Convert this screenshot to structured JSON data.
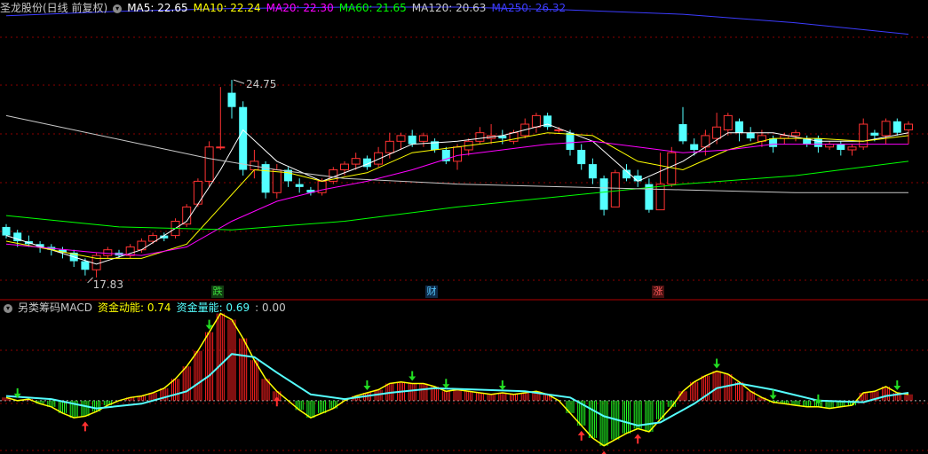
{
  "main_header": {
    "stock": "圣龙股份(日线 前复权)",
    "ma": [
      {
        "label": "MA5: 22.65",
        "color": "#ffffff"
      },
      {
        "label": "MA10: 22.24",
        "color": "#ffff00"
      },
      {
        "label": "MA20: 22.30",
        "color": "#ff00ff"
      },
      {
        "label": "MA60: 21.65",
        "color": "#00ff00"
      },
      {
        "label": "MA120: 20.63",
        "color": "#c8c8c8"
      },
      {
        "label": "MA250: 26.32",
        "color": "#3c3cff"
      }
    ]
  },
  "sub_header": {
    "indicator": "另类筹码MACD",
    "items": [
      {
        "label": "资金动能: 0.74",
        "color": "#ffff00"
      },
      {
        "label": "资金量能: 0.69",
        "color": "#55ffff"
      },
      {
        "label": ": 0.00",
        "color": "#c8c8c8"
      }
    ]
  },
  "annotations": {
    "high": "24.75",
    "low": "17.83"
  },
  "event_tags": [
    {
      "text": "跌",
      "color": "#3cdc3c",
      "bg": "#123d12"
    },
    {
      "text": "财",
      "color": "#55c8ff",
      "bg": "#0e2a48"
    },
    {
      "text": "涨",
      "color": "#ff5a5a",
      "bg": "#481010"
    }
  ],
  "colors": {
    "up": "#ff3232",
    "down": "#54ffff",
    "grid": "#8b0000",
    "macd_up": "#ff2020",
    "macd_down": "#22ff22"
  },
  "chart_data": [
    {
      "type": "candlestick",
      "price_range": [
        17.3,
        27.3
      ],
      "candles": [
        [
          19.6,
          19.7,
          19.2,
          19.3
        ],
        [
          19.4,
          19.5,
          18.9,
          19.1
        ],
        [
          19.1,
          19.3,
          18.9,
          19.0
        ],
        [
          19.0,
          19.1,
          18.7,
          18.9
        ],
        [
          18.9,
          19.0,
          18.6,
          18.8
        ],
        [
          18.8,
          18.9,
          18.5,
          18.7
        ],
        [
          18.7,
          18.8,
          18.2,
          18.4
        ],
        [
          18.4,
          18.5,
          17.9,
          18.1
        ],
        [
          18.1,
          18.7,
          17.83,
          18.6
        ],
        [
          18.6,
          18.9,
          18.5,
          18.8
        ],
        [
          18.7,
          18.8,
          18.5,
          18.6
        ],
        [
          18.6,
          19.0,
          18.5,
          18.9
        ],
        [
          18.8,
          19.2,
          18.7,
          19.1
        ],
        [
          19.1,
          19.4,
          19.0,
          19.3
        ],
        [
          19.3,
          19.4,
          19.1,
          19.2
        ],
        [
          19.3,
          19.9,
          19.2,
          19.8
        ],
        [
          19.7,
          20.4,
          19.6,
          20.3
        ],
        [
          20.4,
          21.3,
          20.3,
          21.2
        ],
        [
          21.2,
          22.6,
          21.0,
          22.4
        ],
        [
          22.4,
          24.5,
          22.3,
          22.4
        ],
        [
          24.3,
          24.75,
          23.4,
          23.8
        ],
        [
          23.8,
          24.0,
          21.4,
          21.6
        ],
        [
          21.6,
          22.3,
          21.3,
          21.9
        ],
        [
          21.8,
          21.9,
          20.6,
          20.8
        ],
        [
          20.8,
          21.8,
          20.6,
          21.6
        ],
        [
          21.6,
          21.7,
          21.0,
          21.2
        ],
        [
          21.1,
          21.3,
          20.8,
          21.0
        ],
        [
          20.9,
          21.0,
          20.7,
          20.8
        ],
        [
          20.8,
          21.3,
          20.7,
          21.2
        ],
        [
          21.2,
          21.7,
          21.1,
          21.6
        ],
        [
          21.6,
          21.9,
          21.4,
          21.8
        ],
        [
          21.8,
          22.2,
          21.6,
          22.0
        ],
        [
          22.0,
          22.1,
          21.6,
          21.7
        ],
        [
          21.8,
          22.4,
          21.7,
          22.2
        ],
        [
          22.2,
          22.9,
          22.0,
          22.6
        ],
        [
          22.6,
          22.9,
          22.3,
          22.8
        ],
        [
          22.8,
          23.0,
          22.4,
          22.5
        ],
        [
          22.6,
          22.9,
          22.4,
          22.8
        ],
        [
          22.6,
          22.7,
          22.2,
          22.3
        ],
        [
          22.3,
          22.4,
          21.8,
          21.9
        ],
        [
          21.9,
          22.5,
          21.6,
          22.4
        ],
        [
          22.3,
          22.7,
          22.1,
          22.6
        ],
        [
          22.6,
          23.1,
          22.5,
          22.9
        ],
        [
          22.7,
          23.2,
          22.5,
          22.8
        ],
        [
          22.8,
          23.0,
          22.5,
          22.7
        ],
        [
          22.6,
          23.0,
          22.5,
          22.9
        ],
        [
          22.8,
          23.4,
          22.7,
          23.2
        ],
        [
          23.1,
          23.6,
          22.9,
          23.5
        ],
        [
          23.5,
          23.6,
          23.0,
          23.1
        ],
        [
          23.0,
          23.1,
          22.9,
          23.0
        ],
        [
          22.9,
          23.0,
          22.1,
          22.3
        ],
        [
          22.3,
          22.5,
          21.6,
          21.8
        ],
        [
          21.8,
          22.0,
          21.1,
          21.3
        ],
        [
          21.3,
          21.4,
          20.0,
          20.2
        ],
        [
          20.3,
          21.6,
          20.3,
          21.5
        ],
        [
          21.6,
          21.8,
          21.2,
          21.3
        ],
        [
          21.4,
          21.6,
          21.0,
          21.2
        ],
        [
          21.1,
          21.3,
          20.1,
          20.2
        ],
        [
          20.2,
          22.2,
          20.8,
          21.1
        ],
        [
          21.1,
          22.4,
          21.0,
          22.2
        ],
        [
          23.2,
          23.8,
          22.5,
          22.6
        ],
        [
          22.5,
          22.7,
          22.1,
          22.3
        ],
        [
          22.4,
          23.0,
          22.1,
          22.8
        ],
        [
          22.7,
          23.6,
          22.5,
          23.1
        ],
        [
          23.0,
          23.6,
          22.8,
          23.5
        ],
        [
          23.3,
          23.4,
          22.6,
          22.9
        ],
        [
          22.9,
          23.1,
          22.6,
          22.7
        ],
        [
          22.6,
          23.0,
          22.4,
          22.8
        ],
        [
          22.7,
          22.8,
          22.2,
          22.4
        ],
        [
          22.7,
          22.9,
          22.5,
          22.8
        ],
        [
          22.8,
          23.0,
          22.6,
          22.9
        ],
        [
          22.7,
          22.8,
          22.4,
          22.5
        ],
        [
          22.7,
          22.8,
          22.2,
          22.4
        ],
        [
          22.4,
          22.6,
          22.3,
          22.5
        ],
        [
          22.5,
          22.6,
          22.1,
          22.3
        ],
        [
          22.3,
          22.5,
          22.1,
          22.4
        ],
        [
          22.4,
          23.4,
          22.3,
          23.2
        ],
        [
          22.9,
          23.0,
          22.6,
          22.8
        ],
        [
          22.8,
          23.4,
          22.5,
          23.3
        ],
        [
          23.3,
          23.4,
          22.8,
          22.9
        ],
        [
          23.0,
          23.3,
          22.5,
          23.2
        ]
      ],
      "ma_lines": [
        {
          "name": "MA5",
          "color": "#ffffff",
          "values": [
            [
              0,
              19.3
            ],
            [
              8,
              18.3
            ],
            [
              12,
              18.8
            ],
            [
              16,
              19.8
            ],
            [
              19,
              21.6
            ],
            [
              21,
              23.0
            ],
            [
              24,
              21.9
            ],
            [
              28,
              21.2
            ],
            [
              32,
              21.8
            ],
            [
              36,
              22.5
            ],
            [
              40,
              22.6
            ],
            [
              44,
              22.8
            ],
            [
              48,
              23.2
            ],
            [
              52,
              22.6
            ],
            [
              56,
              21.2
            ],
            [
              60,
              21.9
            ],
            [
              64,
              22.9
            ],
            [
              68,
              22.9
            ],
            [
              72,
              22.6
            ],
            [
              76,
              22.6
            ],
            [
              80,
              22.9
            ]
          ]
        },
        {
          "name": "MA10",
          "color": "#ffff00",
          "values": [
            [
              0,
              19.1
            ],
            [
              8,
              18.5
            ],
            [
              12,
              18.5
            ],
            [
              16,
              19.0
            ],
            [
              19,
              20.3
            ],
            [
              22,
              21.6
            ],
            [
              25,
              21.5
            ],
            [
              28,
              21.2
            ],
            [
              32,
              21.5
            ],
            [
              36,
              22.2
            ],
            [
              40,
              22.4
            ],
            [
              44,
              22.6
            ],
            [
              48,
              22.9
            ],
            [
              52,
              22.8
            ],
            [
              56,
              21.9
            ],
            [
              60,
              21.6
            ],
            [
              64,
              22.3
            ],
            [
              68,
              22.7
            ],
            [
              72,
              22.7
            ],
            [
              76,
              22.6
            ],
            [
              80,
              22.8
            ]
          ]
        },
        {
          "name": "MA20",
          "color": "#ff00ff",
          "values": [
            [
              0,
              19.0
            ],
            [
              8,
              18.7
            ],
            [
              12,
              18.6
            ],
            [
              16,
              18.9
            ],
            [
              20,
              19.8
            ],
            [
              24,
              20.5
            ],
            [
              28,
              20.9
            ],
            [
              32,
              21.2
            ],
            [
              36,
              21.6
            ],
            [
              40,
              22.1
            ],
            [
              44,
              22.3
            ],
            [
              48,
              22.5
            ],
            [
              52,
              22.6
            ],
            [
              56,
              22.4
            ],
            [
              60,
              22.2
            ],
            [
              64,
              22.3
            ],
            [
              68,
              22.5
            ],
            [
              72,
              22.5
            ],
            [
              76,
              22.5
            ],
            [
              80,
              22.5
            ]
          ]
        },
        {
          "name": "MA60",
          "color": "#00ff00",
          "values": [
            [
              0,
              20.0
            ],
            [
              10,
              19.6
            ],
            [
              20,
              19.5
            ],
            [
              30,
              19.8
            ],
            [
              40,
              20.3
            ],
            [
              50,
              20.7
            ],
            [
              60,
              21.1
            ],
            [
              70,
              21.4
            ],
            [
              80,
              21.9
            ]
          ]
        },
        {
          "name": "MA120",
          "color": "#c8c8c8",
          "values": [
            [
              0,
              23.5
            ],
            [
              6,
              23.0
            ],
            [
              12,
              22.5
            ],
            [
              18,
              22.0
            ],
            [
              24,
              21.6
            ],
            [
              30,
              21.3
            ],
            [
              40,
              21.1
            ],
            [
              50,
              21.0
            ],
            [
              60,
              20.9
            ],
            [
              70,
              20.8
            ],
            [
              80,
              20.8
            ]
          ]
        },
        {
          "name": "MA250",
          "color": "#3c3cff",
          "values": [
            [
              0,
              27.0
            ],
            [
              10,
              27.15
            ],
            [
              20,
              27.25
            ],
            [
              30,
              27.3
            ],
            [
              40,
              27.3
            ],
            [
              50,
              27.2
            ],
            [
              60,
              27.05
            ],
            [
              70,
              26.75
            ],
            [
              80,
              26.35
            ]
          ]
        }
      ]
    },
    {
      "type": "macd-bars",
      "value_range": [
        -1.6,
        2.9
      ],
      "histogram": [
        0.1,
        0.0,
        0.05,
        -0.1,
        -0.2,
        -0.4,
        -0.55,
        -0.5,
        -0.35,
        -0.15,
        0.0,
        0.1,
        0.15,
        0.25,
        0.4,
        0.7,
        1.1,
        1.6,
        2.2,
        2.8,
        2.6,
        2.0,
        1.3,
        0.7,
        0.3,
        0.0,
        -0.3,
        -0.55,
        -0.4,
        -0.25,
        0.0,
        0.15,
        0.25,
        0.35,
        0.55,
        0.6,
        0.55,
        0.55,
        0.45,
        0.3,
        0.35,
        0.3,
        0.25,
        0.2,
        0.25,
        0.2,
        0.25,
        0.3,
        0.2,
        0.0,
        -0.4,
        -0.8,
        -1.2,
        -1.45,
        -1.25,
        -1.05,
        -0.9,
        -1.0,
        -0.6,
        -0.2,
        0.3,
        0.6,
        0.8,
        0.95,
        0.85,
        0.6,
        0.3,
        0.1,
        -0.05,
        -0.1,
        -0.15,
        -0.2,
        -0.2,
        -0.25,
        -0.2,
        -0.15,
        0.25,
        0.3,
        0.45,
        0.25,
        0.2
      ],
      "momentum": [
        0.1,
        0.0,
        0.05,
        -0.1,
        -0.2,
        -0.4,
        -0.55,
        -0.5,
        -0.35,
        -0.15,
        0.0,
        0.1,
        0.15,
        0.25,
        0.4,
        0.7,
        1.1,
        1.6,
        2.2,
        2.8,
        2.6,
        2.0,
        1.3,
        0.7,
        0.3,
        0.0,
        -0.3,
        -0.55,
        -0.4,
        -0.25,
        0.0,
        0.15,
        0.25,
        0.35,
        0.55,
        0.6,
        0.55,
        0.55,
        0.45,
        0.3,
        0.35,
        0.3,
        0.25,
        0.2,
        0.25,
        0.2,
        0.25,
        0.3,
        0.2,
        0.0,
        -0.4,
        -0.8,
        -1.2,
        -1.45,
        -1.25,
        -1.05,
        -0.9,
        -1.0,
        -0.6,
        -0.2,
        0.3,
        0.6,
        0.8,
        0.95,
        0.85,
        0.6,
        0.3,
        0.1,
        -0.05,
        -0.1,
        -0.15,
        -0.2,
        -0.2,
        -0.25,
        -0.2,
        -0.15,
        0.25,
        0.3,
        0.45,
        0.25,
        0.2
      ],
      "volume_line": [
        [
          0,
          0.15
        ],
        [
          4,
          0.05
        ],
        [
          8,
          -0.25
        ],
        [
          12,
          -0.1
        ],
        [
          16,
          0.3
        ],
        [
          18,
          0.8
        ],
        [
          20,
          1.5
        ],
        [
          22,
          1.4
        ],
        [
          24,
          0.9
        ],
        [
          27,
          0.2
        ],
        [
          30,
          0.05
        ],
        [
          34,
          0.25
        ],
        [
          38,
          0.4
        ],
        [
          42,
          0.35
        ],
        [
          46,
          0.3
        ],
        [
          50,
          0.1
        ],
        [
          53,
          -0.5
        ],
        [
          56,
          -0.8
        ],
        [
          58,
          -0.7
        ],
        [
          61,
          -0.1
        ],
        [
          63,
          0.4
        ],
        [
          65,
          0.55
        ],
        [
          68,
          0.35
        ],
        [
          72,
          0.0
        ],
        [
          76,
          -0.05
        ],
        [
          78,
          0.15
        ],
        [
          80,
          0.25
        ]
      ],
      "arrows": [
        {
          "i": 1,
          "dir": "down"
        },
        {
          "i": 7,
          "dir": "up"
        },
        {
          "i": 18,
          "dir": "down"
        },
        {
          "i": 24,
          "dir": "up"
        },
        {
          "i": 32,
          "dir": "down"
        },
        {
          "i": 36,
          "dir": "down"
        },
        {
          "i": 39,
          "dir": "down"
        },
        {
          "i": 44,
          "dir": "down"
        },
        {
          "i": 51,
          "dir": "up"
        },
        {
          "i": 53,
          "dir": "up"
        },
        {
          "i": 56,
          "dir": "up"
        },
        {
          "i": 63,
          "dir": "down"
        },
        {
          "i": 68,
          "dir": "down"
        },
        {
          "i": 72,
          "dir": "down"
        },
        {
          "i": 79,
          "dir": "down"
        }
      ]
    }
  ]
}
